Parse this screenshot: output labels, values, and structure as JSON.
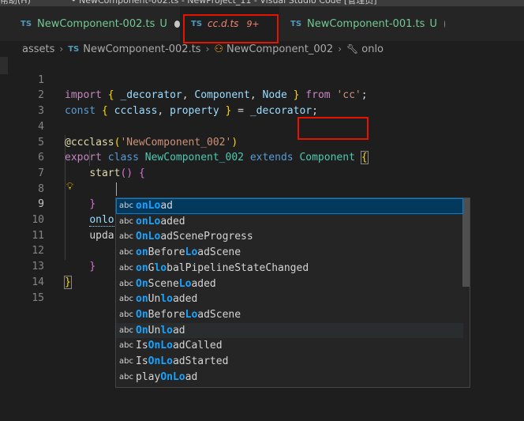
{
  "titlebar": {
    "text_left": "帮助(H)",
    "text_right": "• NewComponent-002.ts - NewProject_11 - Visual Studio Code [管理员]"
  },
  "tabs": [
    {
      "icon": "TS",
      "label": "NewComponent-002.ts",
      "status": "U",
      "state": "modified-unsaved"
    },
    {
      "icon": "TS",
      "label": "cc.d.ts",
      "status": "9+",
      "state": "active"
    },
    {
      "icon": "TS",
      "label": "NewComponent-001.ts",
      "status": "U",
      "state": "modified"
    }
  ],
  "breadcrumb": {
    "folder": "assets",
    "file_icon": "TS",
    "file": "NewComponent-002.ts",
    "class": "NewComponent_002",
    "member": "onlo"
  },
  "editor": {
    "current_line": 9,
    "lines": [
      {
        "n": "1"
      },
      {
        "n": "2"
      },
      {
        "n": "3"
      },
      {
        "n": "4"
      },
      {
        "n": "5"
      },
      {
        "n": "6"
      },
      {
        "n": "7"
      },
      {
        "n": "8"
      },
      {
        "n": "9"
      },
      {
        "n": "10"
      },
      {
        "n": "11"
      },
      {
        "n": "12"
      },
      {
        "n": "13"
      },
      {
        "n": "14"
      },
      {
        "n": "15"
      }
    ],
    "tokens": {
      "l1_import": "import",
      "l1_decorator": "_decorator",
      "l1_component": "Component",
      "l1_node": "Node",
      "l1_from": "from",
      "l1_cc": "'cc'",
      "l2_const": "const",
      "l2_ccclass": "ccclass",
      "l2_property": "property",
      "l2_decorator": "_decorator",
      "l4_at": "@ccclass",
      "l4_name": "'NewComponent_002'",
      "l5_export": "export",
      "l5_class": "class",
      "l5_name": "NewComponent_002",
      "l5_extends": "extends",
      "l5_base": "Component",
      "l6_start": "start",
      "l9_typed": "onlo",
      "l10_upda": "upda"
    }
  },
  "suggestions": [
    {
      "kind": "abc",
      "text": "onLoad",
      "state": "selected"
    },
    {
      "kind": "abc",
      "text": "onLoaded",
      "state": ""
    },
    {
      "kind": "abc",
      "text": "OnLoadSceneProgress",
      "state": ""
    },
    {
      "kind": "abc",
      "text": "onBeforeLoadScene",
      "state": ""
    },
    {
      "kind": "abc",
      "text": "onGlobalPipelineStateChanged",
      "state": ""
    },
    {
      "kind": "abc",
      "text": "OnSceneLoaded",
      "state": ""
    },
    {
      "kind": "abc",
      "text": "onUnloaded",
      "state": ""
    },
    {
      "kind": "abc",
      "text": "OnBeforeLoadScene",
      "state": ""
    },
    {
      "kind": "abc",
      "text": "OnUnload",
      "state": "hover"
    },
    {
      "kind": "abc",
      "text": "IsOnLoadCalled",
      "state": ""
    },
    {
      "kind": "abc",
      "text": "IsOnLoadStarted",
      "state": ""
    },
    {
      "kind": "abc",
      "text": "playOnLoad",
      "state": ""
    }
  ],
  "colors": {
    "highlight_box": "#e51400",
    "match_highlight": "#18a3ff",
    "selected_row": "#04395e"
  }
}
